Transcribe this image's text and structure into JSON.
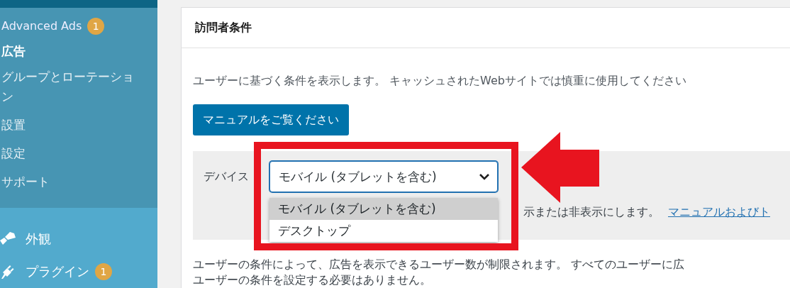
{
  "sidebar": {
    "parent": {
      "label": "Advanced Ads",
      "badge": "1"
    },
    "submenu": [
      {
        "label": "広告",
        "selected": true
      },
      {
        "label": "グループとローテーション",
        "selected": false
      },
      {
        "label": "設置",
        "selected": false
      },
      {
        "label": "設定",
        "selected": false
      },
      {
        "label": "サポート",
        "selected": false
      }
    ],
    "menu": [
      {
        "label": "外観"
      },
      {
        "label": "プラグイン",
        "badge": "1"
      }
    ]
  },
  "panel": {
    "title": "訪問者条件",
    "intro": "ユーザーに基づく条件を表示します。 キャッシュされたWebサイトでは慎重に使用してください",
    "manual_button": "マニュアルをご覧ください",
    "condition": {
      "label": "デバイス",
      "select": {
        "value": "モバイル (タブレットを含む)",
        "expanded": true,
        "options": [
          {
            "label": "モバイル (タブレットを含む)",
            "selected": true
          },
          {
            "label": "デスクトップ",
            "selected": false
          }
        ]
      },
      "description": "示または非表示にします。",
      "link": "マニュアルおよびト"
    },
    "footer_lines": [
      "ユーザーの条件によって、広告を表示できるユーザー数が制限されます。 すべてのユーザーに広",
      "ユーザーの条件を設定する必要はありません。"
    ]
  }
}
